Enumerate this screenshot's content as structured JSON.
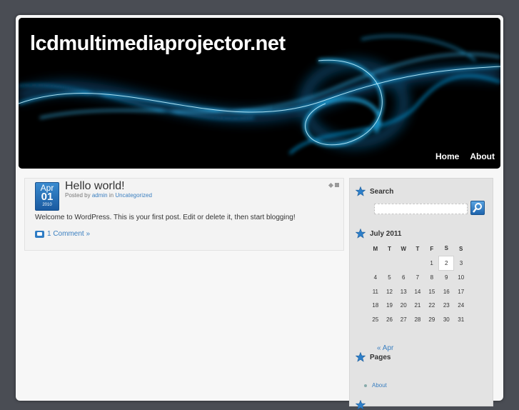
{
  "site": {
    "title": "lcdmultimediaprojector.net"
  },
  "nav": {
    "items": [
      "Home",
      "About"
    ]
  },
  "post": {
    "date_month": "Apr",
    "date_day": "01",
    "date_year": "2010",
    "title": "Hello world!",
    "meta_prefix": "Posted by",
    "author": "admin",
    "meta_in": "in",
    "category": "Uncategorized",
    "content": "Welcome to WordPress. This is your first post. Edit or delete it, then start blogging!",
    "comments": "1 Comment »"
  },
  "sidebar": {
    "search_title": "Search",
    "calendar": {
      "title": "July 2011",
      "weekdays": [
        "M",
        "T",
        "W",
        "T",
        "F",
        "S",
        "S"
      ],
      "weeks": [
        [
          "",
          "",
          "",
          "",
          "1",
          "2",
          "3"
        ],
        [
          "4",
          "5",
          "6",
          "7",
          "8",
          "9",
          "10"
        ],
        [
          "11",
          "12",
          "13",
          "14",
          "15",
          "16",
          "17"
        ],
        [
          "18",
          "19",
          "20",
          "21",
          "22",
          "23",
          "24"
        ],
        [
          "25",
          "26",
          "27",
          "28",
          "29",
          "30",
          "31"
        ]
      ],
      "today": "2",
      "prev_link": "« Apr"
    },
    "pages_title": "Pages",
    "pages": [
      "About"
    ]
  },
  "colors": {
    "background": "#4a4d54",
    "link": "#3a7fc0",
    "accent": "#1e64ad"
  },
  "icons": {
    "widget": "star-icon",
    "search_button": "magnifier-icon",
    "comments": "speech-bubble-icon"
  }
}
